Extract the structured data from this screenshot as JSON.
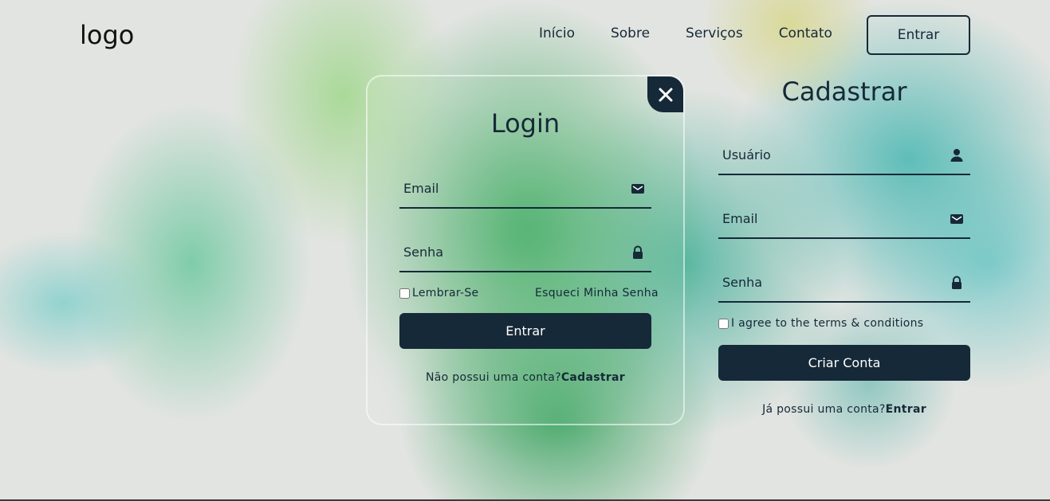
{
  "header": {
    "logo": "logo",
    "nav": [
      "Início",
      "Sobre",
      "Serviços",
      "Contato"
    ],
    "login_button": "Entrar"
  },
  "login": {
    "title": "Login",
    "email_placeholder": "Email",
    "password_placeholder": "Senha",
    "remember_label": "Lembrar-Se",
    "forgot_label": "Esqueci Minha Senha",
    "submit_label": "Entrar",
    "switch_text": "Não possui uma conta?",
    "switch_link": "Cadastrar"
  },
  "register": {
    "title": "Cadastrar",
    "username_placeholder": "Usuário",
    "email_placeholder": "Email",
    "password_placeholder": "Senha",
    "terms_label": "I agree to the terms & conditions",
    "submit_label": "Criar Conta",
    "switch_text": "Já possui uma conta?",
    "switch_link": "Entrar"
  },
  "icons": {
    "close": "close-icon",
    "mail": "mail-icon",
    "lock": "lock-icon",
    "user": "person-icon"
  },
  "colors": {
    "primary": "#162938",
    "background": "#e2e4e1"
  }
}
